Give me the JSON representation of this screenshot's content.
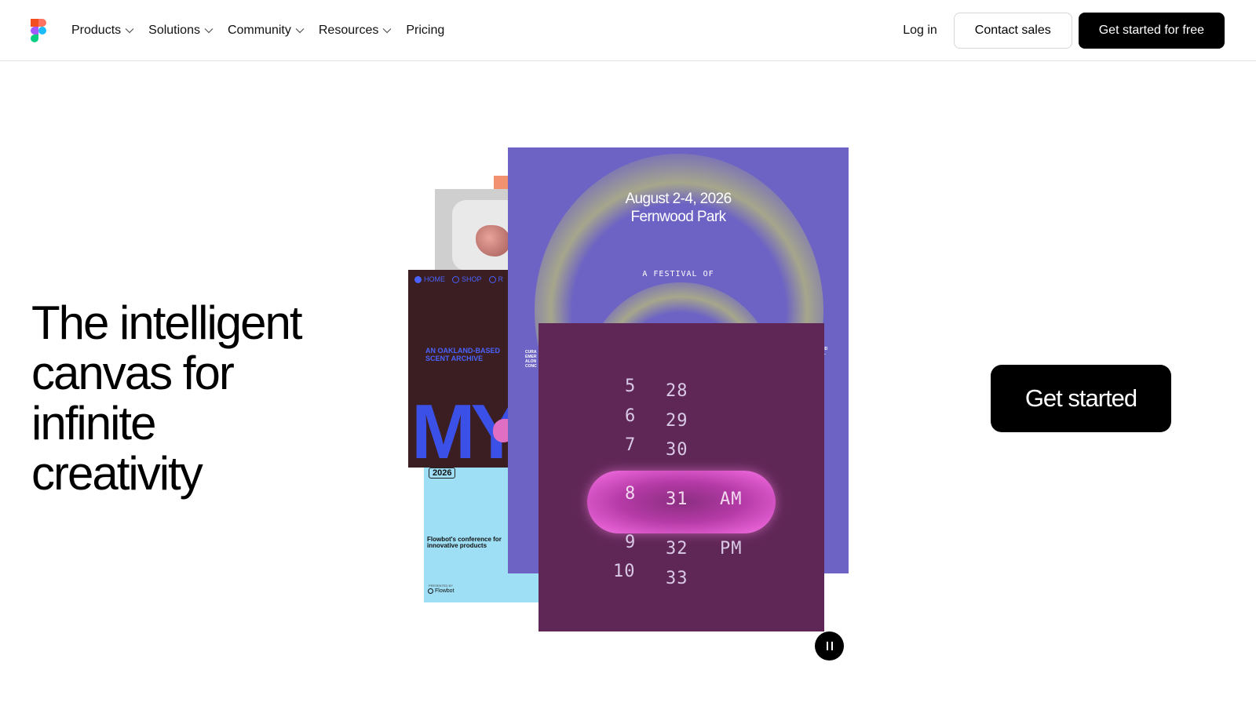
{
  "nav": {
    "items": [
      {
        "label": "Products",
        "has_menu": true
      },
      {
        "label": "Solutions",
        "has_menu": true
      },
      {
        "label": "Community",
        "has_menu": true
      },
      {
        "label": "Resources",
        "has_menu": true
      },
      {
        "label": "Pricing",
        "has_menu": false
      }
    ],
    "login": "Log in",
    "contact": "Contact sales",
    "signup": "Get started for free"
  },
  "hero": {
    "title_lines": [
      "The intelligent",
      "canvas for",
      "infinite",
      "creativity"
    ],
    "cta": "Get started"
  },
  "collage": {
    "archive": {
      "nav": [
        "HOME",
        "SHOP",
        "R"
      ],
      "line1": "AN OAKLAND-BASED",
      "line2": "SCENT ARCHIVE",
      "big": "MY"
    },
    "conference": {
      "year": "2026",
      "text": "Flowbot's conference for innovative products",
      "presented": "PRESENTED BY",
      "brand": "Flowbot"
    },
    "festival": {
      "date": "August 2-4, 2026",
      "place": "Fernwood Park",
      "subtitle": "A FESTIVAL OF",
      "side_left": [
        "CURA",
        "EMER",
        "ALON",
        "CONC"
      ],
      "side_right": [
        "ND",
        "E."
      ]
    },
    "time_picker": {
      "hours": [
        "5",
        "6",
        "7",
        "8",
        "9",
        "10"
      ],
      "minutes": [
        "28",
        "29",
        "30",
        "31",
        "32",
        "33"
      ],
      "periods": [
        "AM",
        "PM"
      ],
      "selected_hour": "8",
      "selected_minute": "31",
      "selected_period": "AM"
    }
  },
  "colors": {
    "accent_dark": "#000000",
    "festival_bg": "#6d63c4",
    "timepicker_bg": "#5f2756",
    "highlight_pill": "#e05ccf",
    "archive_blue": "#3b50e6"
  },
  "icons": {
    "logo": "figma-logo-icon",
    "chevron": "chevron-down-icon",
    "pause": "pause-icon"
  }
}
